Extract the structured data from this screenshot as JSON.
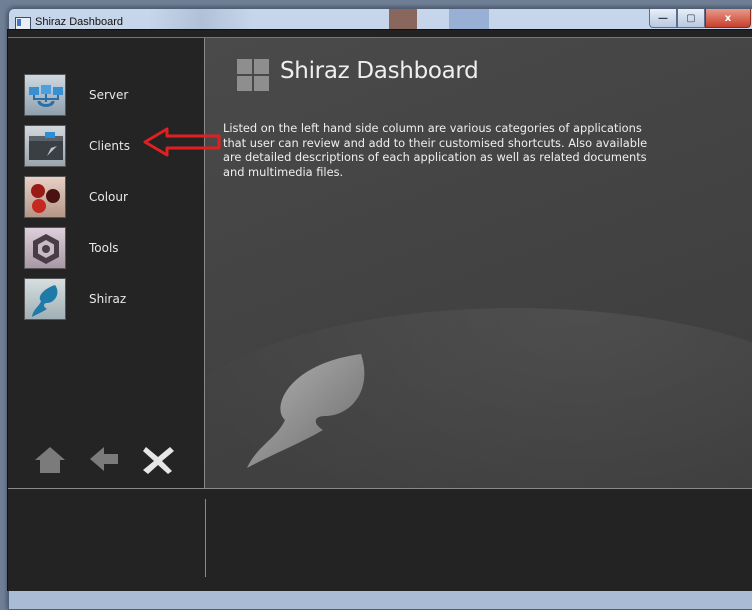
{
  "window": {
    "title": "Shiraz Dashboard",
    "controls": [
      "minimize",
      "maximize",
      "close"
    ],
    "control_glyphs": {
      "minimize": "—",
      "maximize": "▢",
      "close": "x"
    }
  },
  "sidebar": {
    "items": [
      {
        "label": "Server",
        "icon": "server-icon"
      },
      {
        "label": "Clients",
        "icon": "clients-icon"
      },
      {
        "label": "Colour",
        "icon": "colour-icon"
      },
      {
        "label": "Tools",
        "icon": "tools-icon"
      },
      {
        "label": "Shiraz",
        "icon": "shiraz-icon"
      }
    ],
    "bottom_icons": [
      "home-icon",
      "back-arrow-icon",
      "close-icon"
    ]
  },
  "main": {
    "title": "Shiraz Dashboard",
    "description": "Listed on the left hand side column are various categories of applications\nthat user can review and add to their customised shortcuts. Also available\nare detailed descriptions of each application as well as related documents\nand multimedia files."
  },
  "colors": {
    "background": "#232323",
    "panel": "#444444",
    "text": "#efefef",
    "annotation_arrow": "#e02020"
  }
}
